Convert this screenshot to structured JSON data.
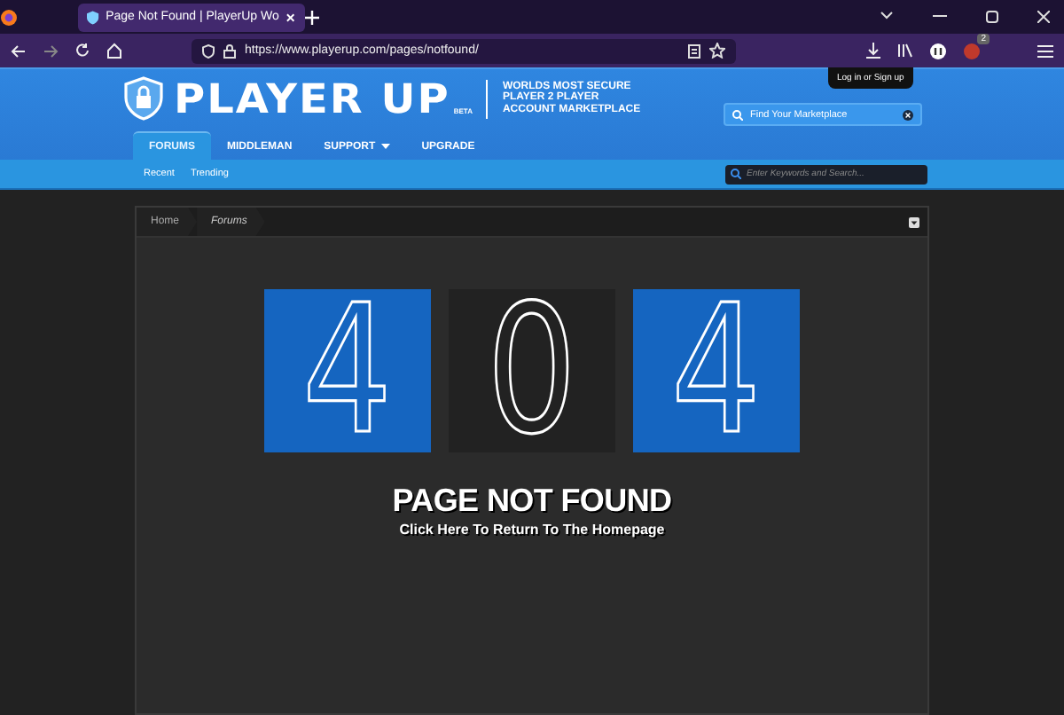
{
  "browser": {
    "tab_title": "Page Not Found | PlayerUp Wo",
    "url": "https://www.playerup.com/pages/notfound/",
    "extension_badge": "2"
  },
  "header": {
    "logo": "PLAYER UP",
    "logo_badge": "BETA",
    "tagline": [
      "WORLDS MOST SECURE",
      "PLAYER 2 PLAYER",
      "ACCOUNT MARKETPLACE"
    ],
    "tooltip": "Log in or Sign up",
    "search": {
      "placeholder": "Find Your Marketplace"
    }
  },
  "nav": [
    {
      "label": "FORUMS",
      "selected": true,
      "has_menu": false
    },
    {
      "label": "MIDDLEMAN",
      "selected": false,
      "has_menu": false
    },
    {
      "label": "SUPPORT",
      "selected": false,
      "has_menu": true
    },
    {
      "label": "UPGRADE",
      "selected": false,
      "has_menu": false
    }
  ],
  "subnav": {
    "links": [
      "Recent",
      "Trending"
    ],
    "search": {
      "placeholder": "Enter Keywords and Search..."
    }
  },
  "breadcrumb": [
    {
      "label": "Home",
      "current": false
    },
    {
      "label": "Forums",
      "current": true
    }
  ],
  "error": {
    "digits": [
      {
        "digit": "4",
        "color": "#1565c0"
      },
      {
        "digit": "0",
        "color": "#222222"
      },
      {
        "digit": "4",
        "color": "#1565c0"
      }
    ],
    "heading": "PAGE NOT FOUND",
    "link": "Click Here To Return To The Homepage"
  }
}
